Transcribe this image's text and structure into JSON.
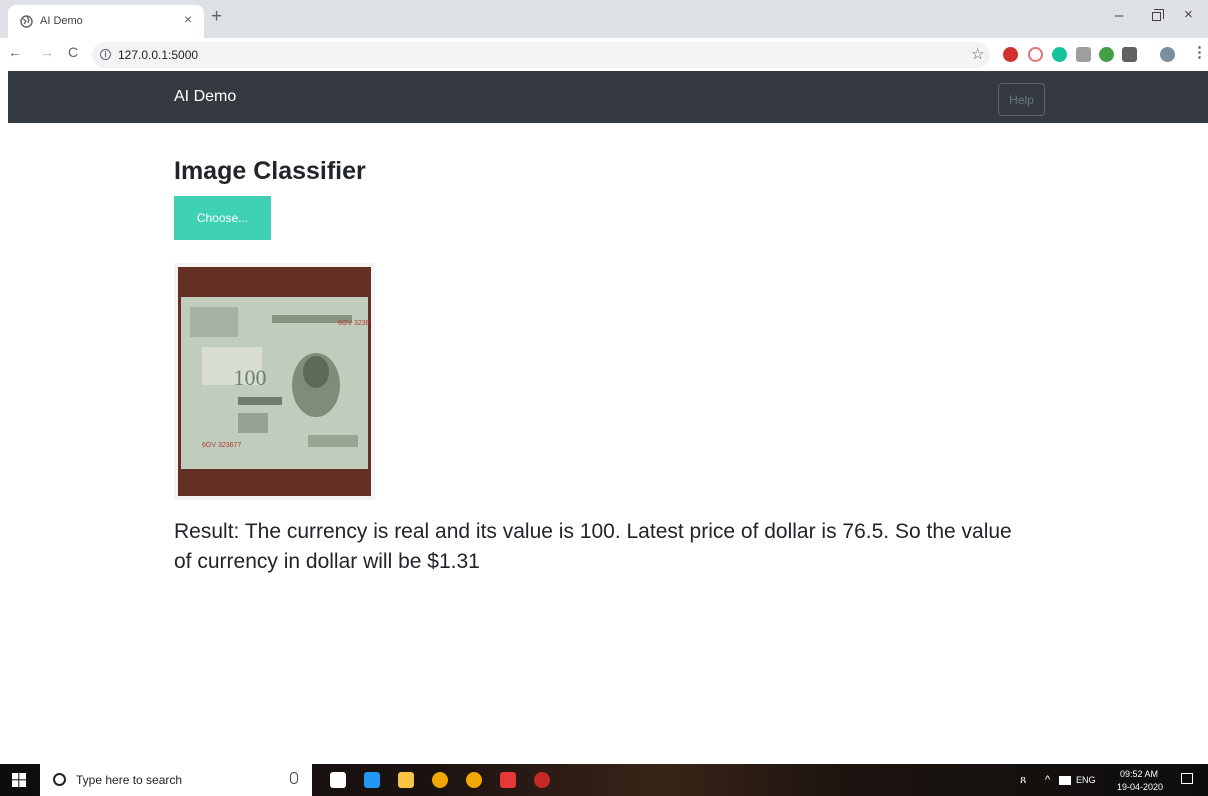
{
  "browser": {
    "tab_title": "AI Demo",
    "tab_close": "×",
    "new_tab": "+",
    "url": "127.0.0.1:5000",
    "back": "←",
    "forward": "→",
    "reload": "C",
    "bookmark": "☆",
    "menu": "⋮",
    "minimize": "–",
    "close": "×"
  },
  "navbar": {
    "brand": "AI Demo",
    "help_label": "Help"
  },
  "main": {
    "heading": "Image Classifier",
    "choose_label": "Choose...",
    "result": "Result: The currency is real and its value is 100. Latest price of dollar is 76.5. So the value of currency in dollar will be $1.31"
  },
  "taskbar": {
    "search_placeholder": "Type here to search",
    "language": "ENG",
    "time": "09:52 AM",
    "date": "19-04-2020"
  },
  "colors": {
    "navbar": "#343a40",
    "accent": "#3fd1b4",
    "tabstrip": "#dee1e6"
  }
}
